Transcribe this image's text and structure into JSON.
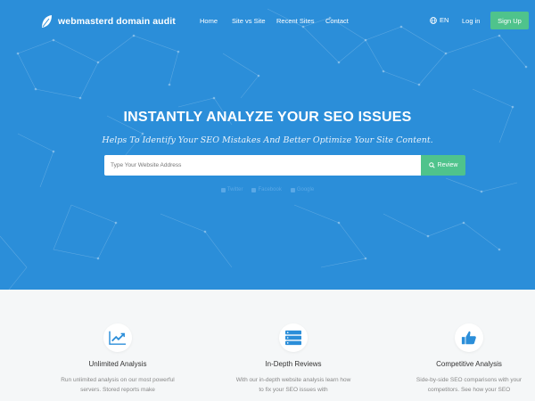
{
  "nav": {
    "brand": "webmasterd domain audit",
    "links": [
      "Home",
      "Site vs Site",
      "Recent Sites",
      "Contact"
    ],
    "language": "EN",
    "login": "Log in",
    "signup": "Sign Up"
  },
  "hero": {
    "title": "INSTANTLY ANALYZE YOUR SEO ISSUES",
    "subtitle": "Helps To Identify Your SEO Mistakes And Better Optimize Your Site Content.",
    "search_placeholder": "Type Your Website Address",
    "review_button": "Review",
    "social": [
      "Twitter",
      "Facebook",
      "Google"
    ]
  },
  "features": [
    {
      "icon": "chart-icon",
      "title": "Unlimited Analysis",
      "description": "Run unlimited analysis on our most powerful servers. Stored reports make"
    },
    {
      "icon": "server-icon",
      "title": "In-Depth Reviews",
      "description": "With our in-depth website analysis learn how to fix your SEO issues with"
    },
    {
      "icon": "thumbs-up-icon",
      "title": "Competitive Analysis",
      "description": "Side-by-side SEO comparisons with your competitors. See how your SEO"
    }
  ],
  "colors": {
    "hero_bg": "#2b8ed9",
    "accent_green": "#4fc38c",
    "page_bg": "#f5f7f8"
  }
}
